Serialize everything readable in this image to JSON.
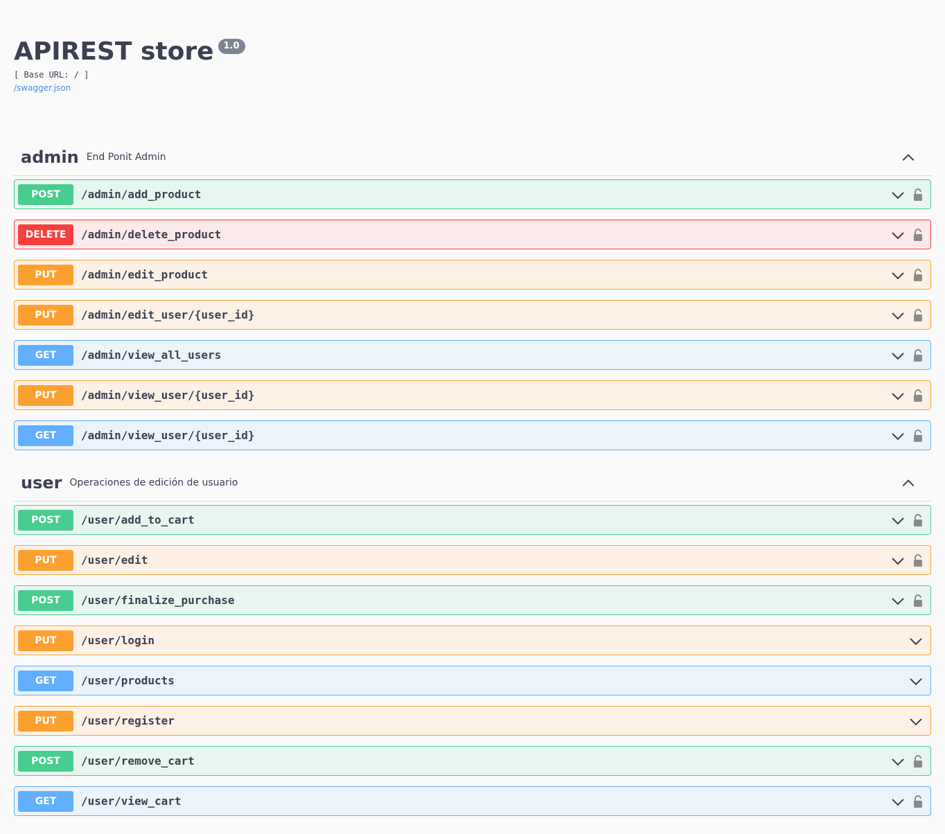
{
  "info": {
    "title": "APIREST store",
    "version": "1.0",
    "base_url": "[ Base URL: / ]",
    "spec_link": "/swagger.json"
  },
  "colors": {
    "post": "#49cc90",
    "delete": "#f93e3e",
    "put": "#fca130",
    "get": "#61affe",
    "link": "#4990e2"
  },
  "sections": [
    {
      "name": "admin",
      "description": "End Ponit Admin",
      "operations": [
        {
          "method": "POST",
          "path": "/admin/add_product",
          "locked": true
        },
        {
          "method": "DELETE",
          "path": "/admin/delete_product",
          "locked": true
        },
        {
          "method": "PUT",
          "path": "/admin/edit_product",
          "locked": true
        },
        {
          "method": "PUT",
          "path": "/admin/edit_user/{user_id}",
          "locked": true
        },
        {
          "method": "GET",
          "path": "/admin/view_all_users",
          "locked": true
        },
        {
          "method": "PUT",
          "path": "/admin/view_user/{user_id}",
          "locked": true
        },
        {
          "method": "GET",
          "path": "/admin/view_user/{user_id}",
          "locked": true
        }
      ]
    },
    {
      "name": "user",
      "description": "Operaciones de edición de usuario",
      "operations": [
        {
          "method": "POST",
          "path": "/user/add_to_cart",
          "locked": true
        },
        {
          "method": "PUT",
          "path": "/user/edit",
          "locked": true
        },
        {
          "method": "POST",
          "path": "/user/finalize_purchase",
          "locked": true
        },
        {
          "method": "PUT",
          "path": "/user/login",
          "locked": false
        },
        {
          "method": "GET",
          "path": "/user/products",
          "locked": false
        },
        {
          "method": "PUT",
          "path": "/user/register",
          "locked": false
        },
        {
          "method": "POST",
          "path": "/user/remove_cart",
          "locked": true
        },
        {
          "method": "GET",
          "path": "/user/view_cart",
          "locked": true
        }
      ]
    }
  ]
}
